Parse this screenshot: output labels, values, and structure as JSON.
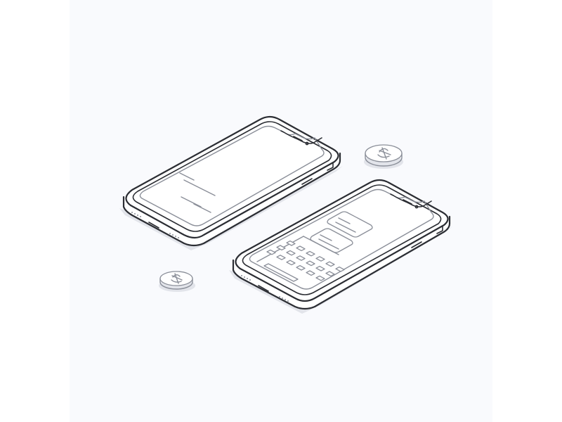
{
  "illustration": {
    "background": "#f9fafd",
    "line_color": "#2b2d33",
    "detail_color": "#8b8f99",
    "objects": [
      "phone-home-screen",
      "phone-chat-keyboard",
      "coin-top-right",
      "coin-bottom-left"
    ],
    "coin_symbol": "crossed-coin-icon"
  }
}
